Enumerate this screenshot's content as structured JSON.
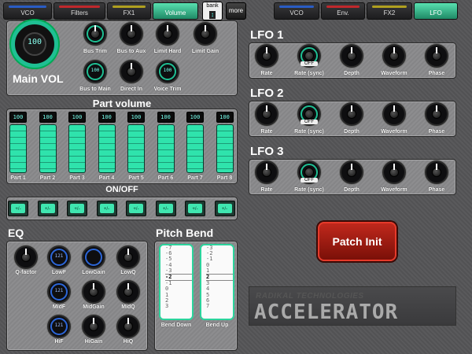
{
  "tabs_left": [
    {
      "label": "VCO",
      "color": "#2a5cc4"
    },
    {
      "label": "Filters",
      "color": "#c0282c"
    },
    {
      "label": "FX1",
      "color": "#b0a020"
    },
    {
      "label": "Volume",
      "color": "#40e0a8",
      "active": true
    }
  ],
  "tabs_right": [
    {
      "label": "VCO",
      "color": "#2a5cc4"
    },
    {
      "label": "Env.",
      "color": "#c0282c"
    },
    {
      "label": "FX2",
      "color": "#b0a020"
    },
    {
      "label": "LFO",
      "color": "#40e0a8",
      "active": true
    }
  ],
  "bank_label": "bank",
  "more_label": "more",
  "main_vol": {
    "label": "Main VOL",
    "value": "100"
  },
  "volume_knobs": [
    {
      "label": "Bus Trim",
      "value": ""
    },
    {
      "label": "Bus to Aux",
      "value": ""
    },
    {
      "label": "Limit Hard",
      "value": ""
    },
    {
      "label": "Limit Gain",
      "value": ""
    },
    {
      "label": "Bus to Main",
      "value": "100"
    },
    {
      "label": "Direct In",
      "value": ""
    },
    {
      "label": "Voice Trim",
      "value": "100"
    }
  ],
  "part_volume": {
    "title": "Part volume",
    "onoff_title": "ON/OFF",
    "parts": [
      {
        "label": "Part 1",
        "value": "100"
      },
      {
        "label": "Part 2",
        "value": "100"
      },
      {
        "label": "Part 3",
        "value": "100"
      },
      {
        "label": "Part 4",
        "value": "100"
      },
      {
        "label": "Part 5",
        "value": "100"
      },
      {
        "label": "Part 6",
        "value": "100"
      },
      {
        "label": "Part 7",
        "value": "100"
      },
      {
        "label": "Part 8",
        "value": "100"
      }
    ],
    "toggle_label": "+/-"
  },
  "eq": {
    "title": "EQ",
    "knobs": [
      {
        "label": "Q-factor",
        "value": ""
      },
      {
        "label": "LowF",
        "value": "121"
      },
      {
        "label": "LowGain",
        "value": ""
      },
      {
        "label": "LowQ",
        "value": ""
      },
      {
        "label": "MidF",
        "value": "121"
      },
      {
        "label": "MidGain",
        "value": ""
      },
      {
        "label": "MidQ",
        "value": ""
      },
      {
        "label": "HiF",
        "value": "121"
      },
      {
        "label": "HiGain",
        "value": ""
      },
      {
        "label": "HiQ",
        "value": ""
      }
    ]
  },
  "pitch_bend": {
    "title": "Pitch Bend",
    "down": {
      "label": "Bend Down",
      "items": [
        "-7",
        "-6",
        "-5",
        "-4",
        "-3",
        "-2",
        "-1",
        "0",
        "1",
        "2",
        "3"
      ],
      "selected": "-2"
    },
    "up": {
      "label": "Bend Up",
      "items": [
        "-3",
        "-2",
        "-1",
        "0",
        "1",
        "2",
        "3",
        "4",
        "5",
        "6",
        "7"
      ],
      "selected": "2"
    }
  },
  "lfos": [
    {
      "title": "LFO 1",
      "knobs": [
        "Rate",
        "Rate (sync)",
        "Depth",
        "Waveform",
        "Phase"
      ],
      "sync": "OFF"
    },
    {
      "title": "LFO 2",
      "knobs": [
        "Rate",
        "Rate (sync)",
        "Depth",
        "Waveform",
        "Phase"
      ],
      "sync": "OFF"
    },
    {
      "title": "LFO 3",
      "knobs": [
        "Rate",
        "Rate (sync)",
        "Depth",
        "Waveform",
        "Phase"
      ],
      "sync": "OFF"
    }
  ],
  "patch_init_label": "Patch Init",
  "logo": {
    "brand": "RADIKAL TECHNOLOGIES",
    "product": "accelerator"
  }
}
